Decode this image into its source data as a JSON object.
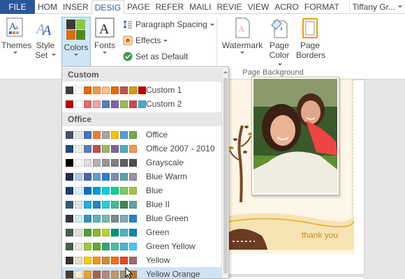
{
  "tabs": [
    {
      "label": "FILE",
      "kind": "file"
    },
    {
      "label": "HOM",
      "kind": "normal"
    },
    {
      "label": "INSER",
      "kind": "normal"
    },
    {
      "label": "DESIG",
      "kind": "active"
    },
    {
      "label": "PAGE",
      "kind": "normal"
    },
    {
      "label": "REFER",
      "kind": "normal"
    },
    {
      "label": "MAILI",
      "kind": "normal"
    },
    {
      "label": "REVIE",
      "kind": "normal"
    },
    {
      "label": "VIEW",
      "kind": "normal"
    },
    {
      "label": "ACRO",
      "kind": "normal"
    },
    {
      "label": "FORMAT",
      "kind": "normal"
    }
  ],
  "user": "Tiffany Gr...",
  "ribbon": {
    "themes_label": "Themes",
    "style_set_line1": "Style",
    "style_set_line2": "Set",
    "colors_label": "Colors",
    "fonts_label": "Fonts",
    "paragraph_spacing": "Paragraph Spacing",
    "effects": "Effects",
    "set_as_default": "Set as Default",
    "watermark_label": "Watermark",
    "page_color_line1": "Page",
    "page_color_line2": "Color",
    "page_borders_line1": "Page",
    "page_borders_line2": "Borders",
    "group_page_background": "Page Background"
  },
  "document": {
    "card_text": "thank you"
  },
  "dropdown": {
    "custom_header": "Custom",
    "office_header": "Office",
    "custom_items": [
      {
        "label": "Custom 1",
        "colors": [
          "#404040",
          "#ffffff",
          "#e36c0a",
          "#f79646",
          "#fac08f",
          "#e46c0a",
          "#c0504d",
          "#d19d04",
          "#c00000"
        ]
      },
      {
        "label": "Custom 2",
        "colors": [
          "#c00000",
          "#ffffff",
          "#e46c6c",
          "#f2a2a2",
          "#4f81bd",
          "#8064a2",
          "#9bbb59",
          "#c0504d",
          "#4bacc6"
        ]
      }
    ],
    "office_items": [
      {
        "label": "Office",
        "colors": [
          "#44546a",
          "#e7e6e6",
          "#4472c4",
          "#ed7d31",
          "#a5a5a5",
          "#ffc000",
          "#5b9bd5",
          "#70ad47"
        ]
      },
      {
        "label": "Office 2007 - 2010",
        "colors": [
          "#1f497d",
          "#eeece1",
          "#4f81bd",
          "#c0504d",
          "#9bbb59",
          "#8064a2",
          "#4bacc6",
          "#f79646"
        ]
      },
      {
        "label": "Grayscale",
        "colors": [
          "#000000",
          "#f8f8f8",
          "#dddddd",
          "#b2b2b2",
          "#969696",
          "#808080",
          "#5f5f5f",
          "#4d4d4d"
        ]
      },
      {
        "label": "Blue Warm",
        "colors": [
          "#242852",
          "#acccea",
          "#4a66ac",
          "#629dd1",
          "#297fd5",
          "#7f8fa9",
          "#5aa2ae",
          "#9d90a0"
        ]
      },
      {
        "label": "Blue",
        "colors": [
          "#17406d",
          "#dbeff9",
          "#0f6fc6",
          "#009dd9",
          "#0bd0d9",
          "#10cf9b",
          "#7cca62",
          "#a5c249"
        ]
      },
      {
        "label": "Blue II",
        "colors": [
          "#335b74",
          "#dfe3e5",
          "#1cade4",
          "#2683c6",
          "#27ced7",
          "#42ba97",
          "#3e8853",
          "#62a39f"
        ]
      },
      {
        "label": "Blue Green",
        "colors": [
          "#373545",
          "#ceedf4",
          "#3494ba",
          "#58b6c0",
          "#75bda7",
          "#7a8c8e",
          "#84acb6",
          "#2683c6"
        ]
      },
      {
        "label": "Green",
        "colors": [
          "#455f51",
          "#e3ded1",
          "#549e39",
          "#8ab833",
          "#c0cf3a",
          "#029676",
          "#4ab5c4",
          "#0989b1"
        ]
      },
      {
        "label": "Green Yellow",
        "colors": [
          "#455f51",
          "#e9e5dc",
          "#99cb38",
          "#63a537",
          "#37a76f",
          "#44c1a3",
          "#4eb3cf",
          "#51c3f9"
        ]
      },
      {
        "label": "Yellow",
        "colors": [
          "#39302a",
          "#e5dec4",
          "#ffca08",
          "#f8931d",
          "#ce8d3e",
          "#ec7016",
          "#e64823",
          "#9c6a6a"
        ]
      },
      {
        "label": "Yellow Orange",
        "colors": [
          "#4e3b30",
          "#fbeec9",
          "#f0a22e",
          "#a5644e",
          "#b58b80",
          "#c3986d",
          "#a19574",
          "#c17529"
        ]
      }
    ]
  }
}
